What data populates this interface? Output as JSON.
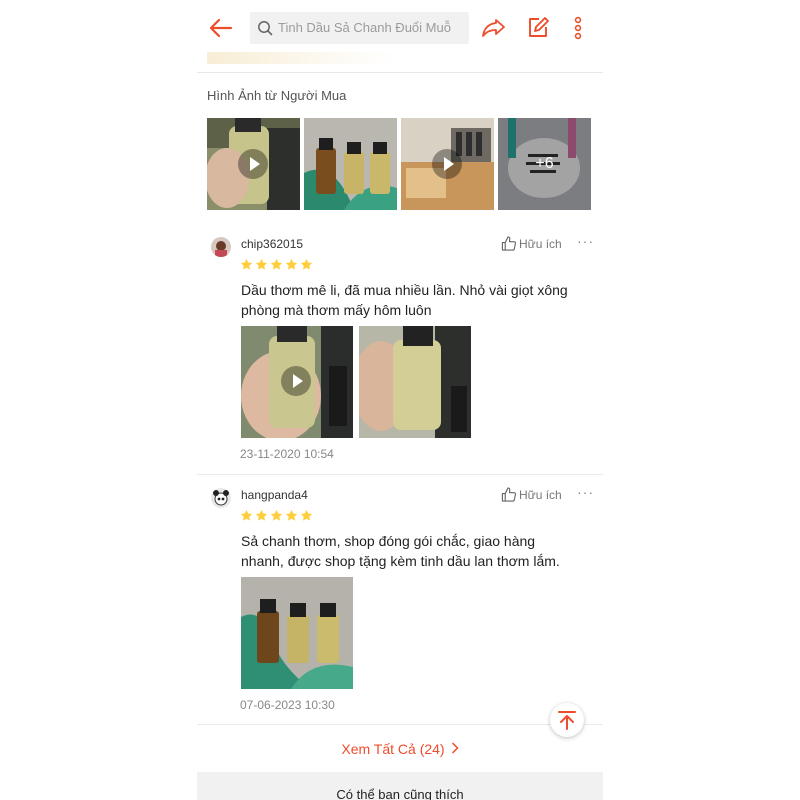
{
  "header": {
    "search_placeholder": "Tinh Dầu Sả Chanh Đuổi Muỗ",
    "accent": "#ee4d2d"
  },
  "section": {
    "title": "Hình Ảnh từ Người Mua"
  },
  "gallery": {
    "more_count": "+6"
  },
  "reviews": [
    {
      "username": "chip362015",
      "rating": 5,
      "helpful_label": "Hữu ích",
      "text": "Dầu thơm mê li, đã mua nhiều lần. Nhỏ vài giọt xông phòng mà thơm mấy hôm luôn",
      "time": "23-11-2020 10:54"
    },
    {
      "username": "hangpanda4",
      "rating": 5,
      "helpful_label": "Hữu ích",
      "text": "Sả chanh thơm, shop đóng gói chắc, giao hàng nhanh, được shop tặng kèm tinh dầu lan thơm lắm.",
      "time": "07-06-2023 10:30"
    }
  ],
  "see_all": {
    "label": "Xem Tất Cả (24)"
  },
  "recommend": {
    "label": "Có thể bạn cũng thích"
  }
}
